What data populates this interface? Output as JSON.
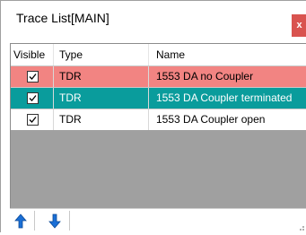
{
  "window": {
    "title": "Trace List[MAIN]",
    "close_label": "x"
  },
  "table": {
    "columns": [
      "Visible",
      "Type",
      "Name"
    ],
    "rows": [
      {
        "visible": true,
        "type": "TDR",
        "name": "1553 DA no Coupler",
        "bg": "#f28482",
        "fg": "#000000"
      },
      {
        "visible": true,
        "type": "TDR",
        "name": "1553 DA Coupler terminated",
        "bg": "#0a9c9c",
        "fg": "#ffffff"
      },
      {
        "visible": true,
        "type": "TDR",
        "name": "1553 DA Coupler open",
        "bg": "#ffffff",
        "fg": "#000000"
      }
    ]
  },
  "toolbar": {
    "move_up_icon": "arrow-up-icon",
    "move_down_icon": "arrow-down-icon"
  },
  "colors": {
    "accent_blue": "#1a6fd6",
    "close_red": "#d9534f",
    "grid_empty": "#a0a0a0"
  }
}
